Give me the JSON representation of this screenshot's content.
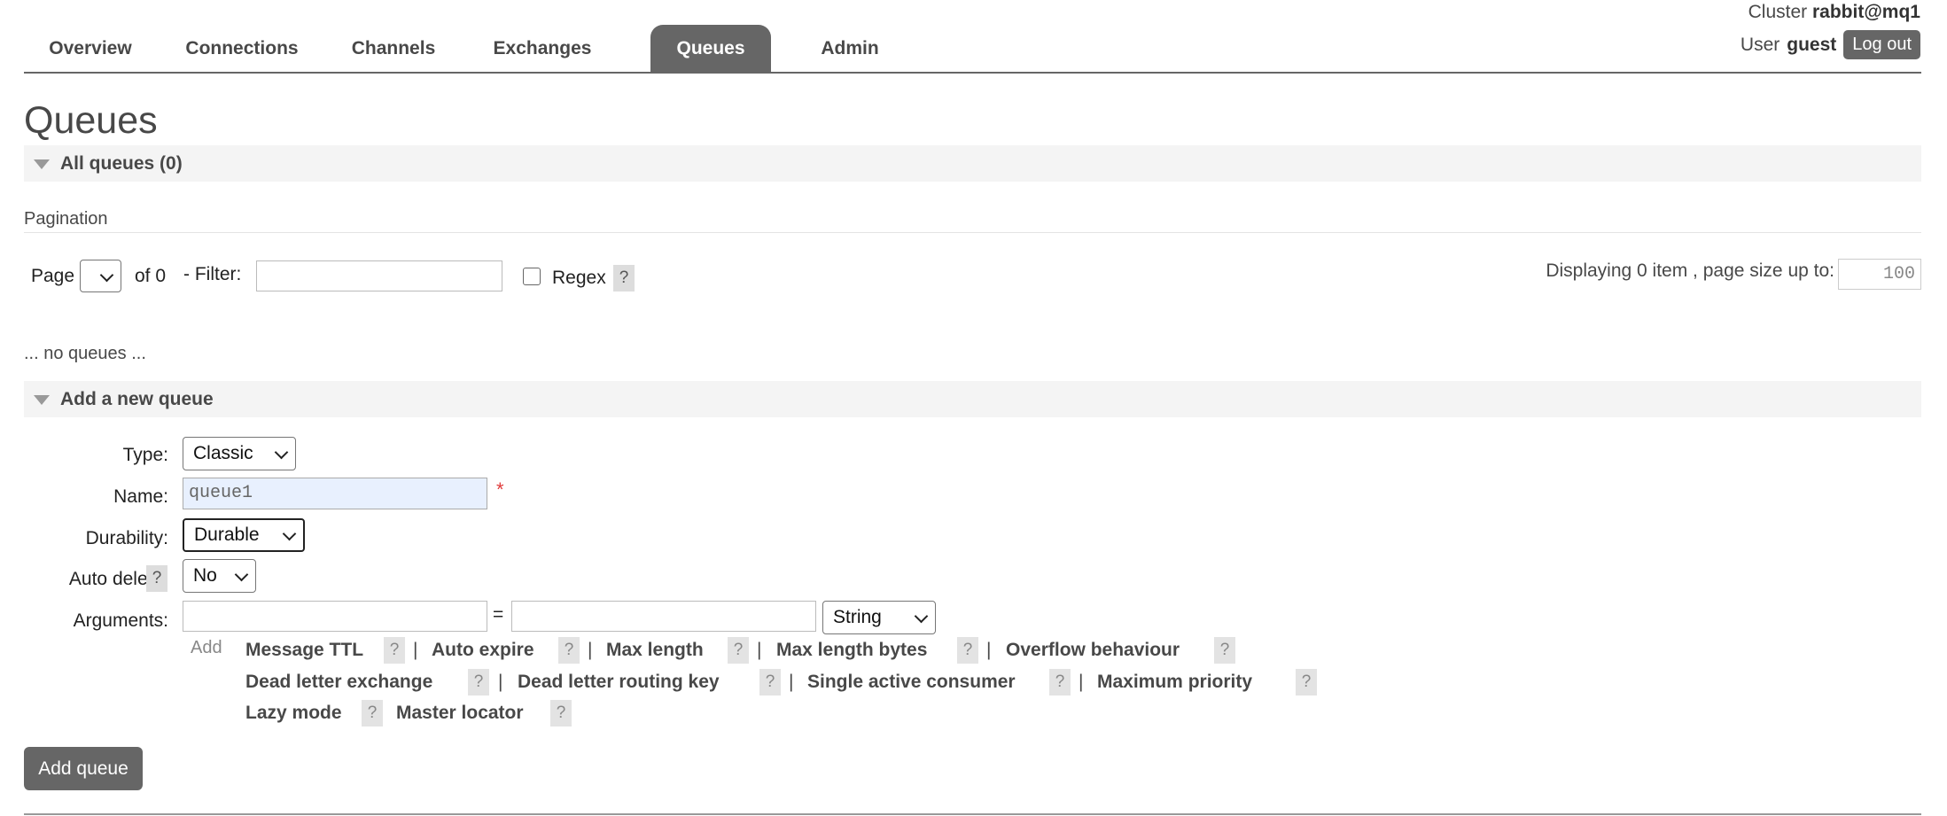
{
  "header": {
    "tabs": [
      {
        "label": "Overview"
      },
      {
        "label": "Connections"
      },
      {
        "label": "Channels"
      },
      {
        "label": "Exchanges"
      },
      {
        "label": "Queues",
        "active": true
      },
      {
        "label": "Admin"
      }
    ],
    "cluster_label": "Cluster",
    "cluster_name": "rabbit@mq1",
    "user_label": "User",
    "user_name": "guest",
    "logout_label": "Log out"
  },
  "page_title": "Queues",
  "all_queues": {
    "section_label": "All queues (0)",
    "pagination_heading": "Pagination",
    "page_label": "Page",
    "page_value": "",
    "of_label": "of 0",
    "filter_label": "- Filter:",
    "filter_value": "",
    "regex_label": "Regex",
    "help_label": "?",
    "displaying_label": "Displaying 0 item , page size up to:",
    "page_size_value": "100",
    "empty_message": "... no queues ..."
  },
  "add_queue": {
    "section_label": "Add a new queue",
    "type_label": "Type:",
    "type_value": "Classic",
    "name_label": "Name:",
    "name_value": "queue1",
    "required_mark": "*",
    "durability_label": "Durability:",
    "durability_value": "Durable",
    "auto_delete_label": "Auto delete:",
    "auto_delete_value": "No",
    "arguments_label": "Arguments:",
    "equals": "=",
    "arg_type_value": "String",
    "add_label": "Add",
    "pipe": "|",
    "argument_links": [
      "Message TTL",
      "Auto expire",
      "Max length",
      "Max length bytes",
      "Overflow behaviour",
      "Dead letter exchange",
      "Dead letter routing key",
      "Single active consumer",
      "Maximum priority",
      "Lazy mode",
      "Master locator"
    ],
    "submit_label": "Add queue"
  },
  "colors": {
    "active_tab_bg": "#666666",
    "section_bar_bg": "#f4f4f4",
    "name_field_bg": "#e8f0fe",
    "required_star": "#e03c3c"
  }
}
